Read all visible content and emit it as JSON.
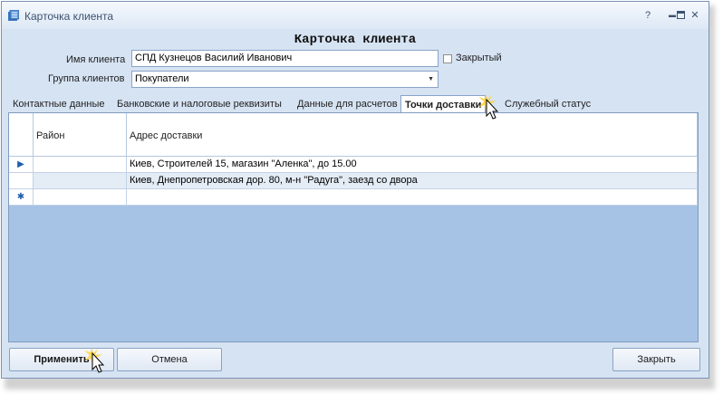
{
  "window": {
    "title": "Карточка клиента",
    "header": "Карточка клиента"
  },
  "form": {
    "client_name_label": "Имя клиента",
    "client_name_value": "СПД Кузнецов Василий Иванович",
    "closed_label": "Закрытый",
    "closed_checked": false,
    "client_group_label": "Группа клиентов",
    "client_group_value": "Покупатели"
  },
  "tabs": [
    {
      "label": "Контактные данные",
      "active": false
    },
    {
      "label": "Банковские и налоговые реквизиты",
      "active": false
    },
    {
      "label": "Данные для расчетов",
      "active": false
    },
    {
      "label": "Точки доставки",
      "active": true
    },
    {
      "label": "Служебный статус",
      "active": false
    }
  ],
  "grid": {
    "columns": [
      "Район",
      "Адрес доставки"
    ],
    "rows": [
      {
        "district": "",
        "address": "Киев, Строителей 15, магазин \"Аленка\", до 15.00",
        "current": true
      },
      {
        "district": "",
        "address": "Киев, Днепропетровская дор. 80, м-н \"Радуга\", заезд со двора",
        "current": false
      }
    ],
    "new_row_marker": "✱",
    "current_row_marker": "▶"
  },
  "buttons": {
    "apply": "Применить",
    "cancel": "Отмена",
    "close": "Закрыть"
  },
  "titlebar_buttons": {
    "help": "?",
    "minimize": "▬",
    "maximize": "□",
    "close": "✕"
  },
  "colors": {
    "accent": "#1c5fb0",
    "grid_background": "#a6c3e5",
    "window_background": "#d6e3f3"
  }
}
